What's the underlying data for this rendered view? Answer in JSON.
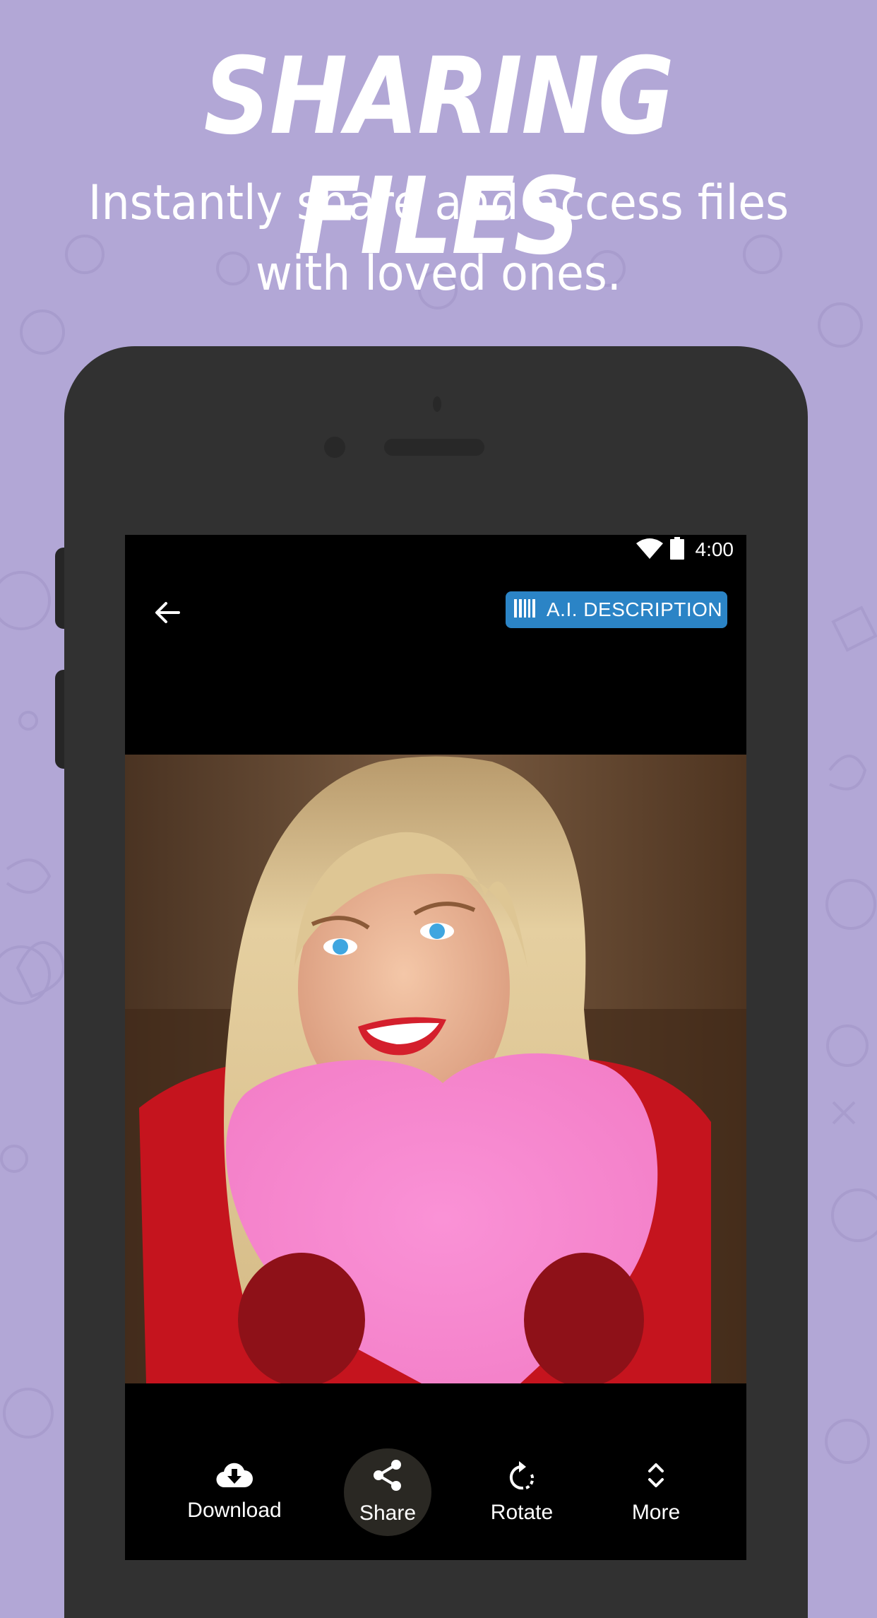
{
  "promo": {
    "headline": "SHARING FILES",
    "subhead": "Instantly share and access files with loved ones."
  },
  "colors": {
    "background": "#B2A7D6",
    "phone_body": "#313131",
    "accent": "#2B84C6",
    "screen": "#000000",
    "active_tool_bg": "#2A2823"
  },
  "status_bar": {
    "wifi_icon": "wifi-icon",
    "battery_icon": "battery-icon",
    "time": "4:00"
  },
  "app_bar": {
    "back_icon": "arrow-back-icon",
    "ai_button": {
      "icon": "barcode-icon",
      "label": "A.I. DESCRIPTION"
    }
  },
  "photo": {
    "description": "Smiling blonde woman in red sweater and red knit mittens holding a pink felt heart"
  },
  "toolbar": {
    "items": [
      {
        "label": "Download",
        "icon": "cloud-download-icon",
        "active": false
      },
      {
        "label": "Share",
        "icon": "share-icon",
        "active": true
      },
      {
        "label": "Rotate",
        "icon": "rotate-icon",
        "active": false
      },
      {
        "label": "More",
        "icon": "unfold-more-icon",
        "active": false
      }
    ]
  }
}
